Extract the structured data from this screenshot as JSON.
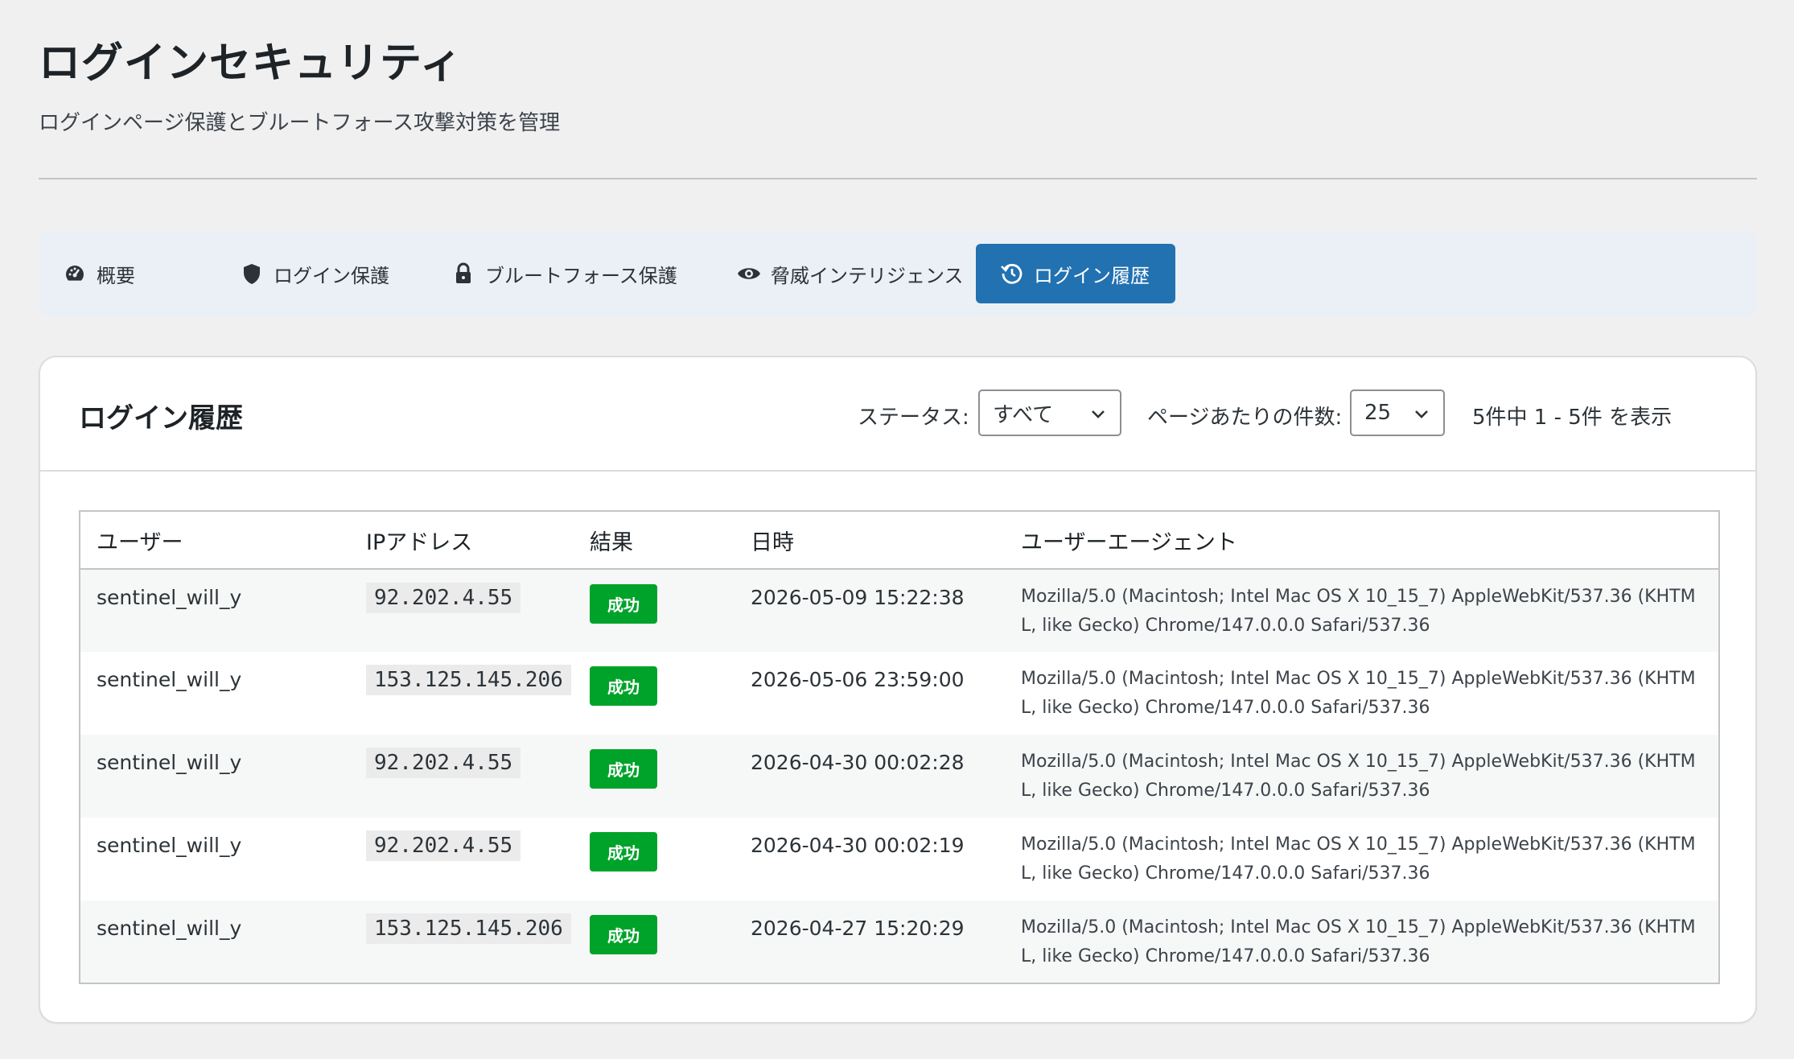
{
  "header": {
    "title": "ログインセキュリティ",
    "subtitle": "ログインページ保護とブルートフォース攻撃対策を管理"
  },
  "tabs": [
    {
      "label": "概要",
      "icon": "dashboard-icon",
      "active": false
    },
    {
      "label": "ログイン保護",
      "icon": "shield-icon",
      "active": false
    },
    {
      "label": "ブルートフォース保護",
      "icon": "lock-icon",
      "active": false
    },
    {
      "label": "脅威インテリジェンス",
      "icon": "eye-icon",
      "active": false
    },
    {
      "label": "ログイン履歴",
      "icon": "history-icon",
      "active": true
    }
  ],
  "card": {
    "title": "ログイン履歴",
    "status_label": "ステータス:",
    "status_value": "すべて",
    "per_page_label": "ページあたりの件数:",
    "per_page_value": "25",
    "pager_text": "5件中 1 - 5件 を表示"
  },
  "table": {
    "columns": [
      "ユーザー",
      "IPアドレス",
      "結果",
      "日時",
      "ユーザーエージェント"
    ],
    "rows": [
      {
        "user": "sentinel_will_y",
        "ip": "92.202.4.55",
        "result": "成功",
        "datetime": "2026-05-09 15:22:38",
        "ua": "Mozilla/5.0 (Macintosh; Intel Mac OS X 10_15_7) AppleWebKit/537.36 (KHTML, like Gecko) Chrome/147.0.0.0 Safari/537.36"
      },
      {
        "user": "sentinel_will_y",
        "ip": "153.125.145.206",
        "result": "成功",
        "datetime": "2026-05-06 23:59:00",
        "ua": "Mozilla/5.0 (Macintosh; Intel Mac OS X 10_15_7) AppleWebKit/537.36 (KHTML, like Gecko) Chrome/147.0.0.0 Safari/537.36"
      },
      {
        "user": "sentinel_will_y",
        "ip": "92.202.4.55",
        "result": "成功",
        "datetime": "2026-04-30 00:02:28",
        "ua": "Mozilla/5.0 (Macintosh; Intel Mac OS X 10_15_7) AppleWebKit/537.36 (KHTML, like Gecko) Chrome/147.0.0.0 Safari/537.36"
      },
      {
        "user": "sentinel_will_y",
        "ip": "92.202.4.55",
        "result": "成功",
        "datetime": "2026-04-30 00:02:19",
        "ua": "Mozilla/5.0 (Macintosh; Intel Mac OS X 10_15_7) AppleWebKit/537.36 (KHTML, like Gecko) Chrome/147.0.0.0 Safari/537.36"
      },
      {
        "user": "sentinel_will_y",
        "ip": "153.125.145.206",
        "result": "成功",
        "datetime": "2026-04-27 15:20:29",
        "ua": "Mozilla/5.0 (Macintosh; Intel Mac OS X 10_15_7) AppleWebKit/537.36 (KHTML, like Gecko) Chrome/147.0.0.0 Safari/537.36"
      }
    ]
  },
  "colors": {
    "accent": "#2271b1",
    "success": "#00a32a"
  }
}
